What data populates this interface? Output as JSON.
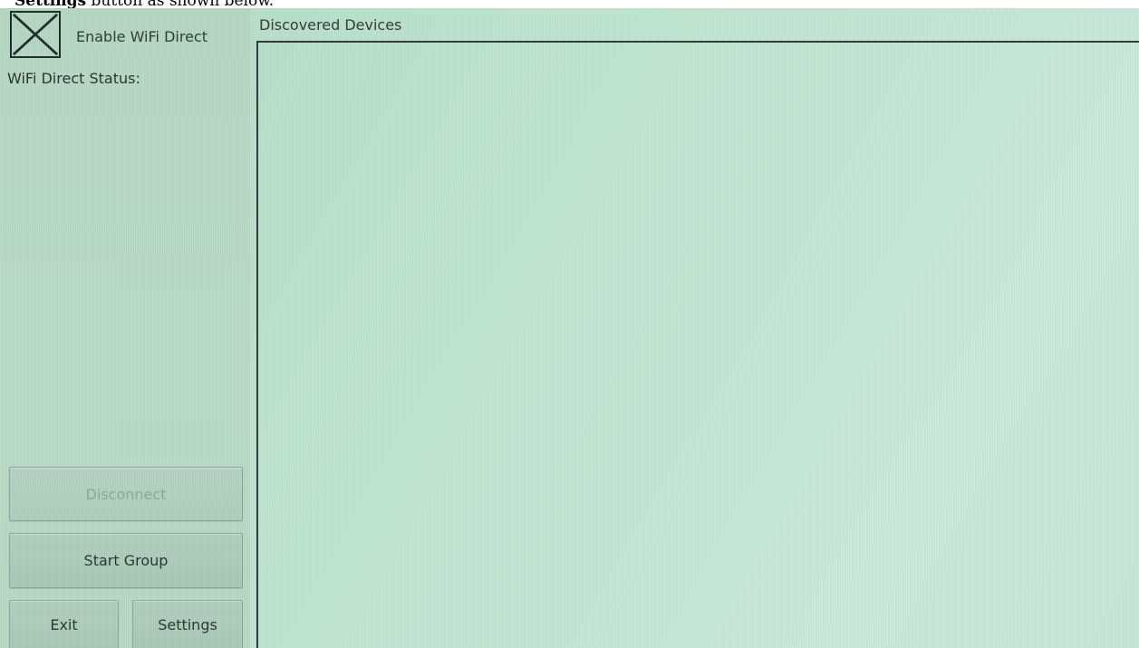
{
  "caption": {
    "bold": "Settings",
    "rest": " button as shown below."
  },
  "left_panel": {
    "enable_checkbox": {
      "label": "Enable WiFi Direct",
      "checked": true,
      "icon": "x-mark-icon"
    },
    "status_label": "WiFi Direct Status:",
    "buttons": {
      "disconnect": {
        "label": "Disconnect",
        "disabled": true
      },
      "start_group": {
        "label": "Start Group"
      },
      "exit": {
        "label": "Exit"
      },
      "settings": {
        "label": "Settings"
      }
    }
  },
  "devices": {
    "title": "Discovered Devices",
    "items": []
  },
  "colors": {
    "screen_bg": "#c3e6d6",
    "panel_bg": "#b8d9c6",
    "text": "#2b3a34",
    "disabled_text": "#8aa99a"
  }
}
